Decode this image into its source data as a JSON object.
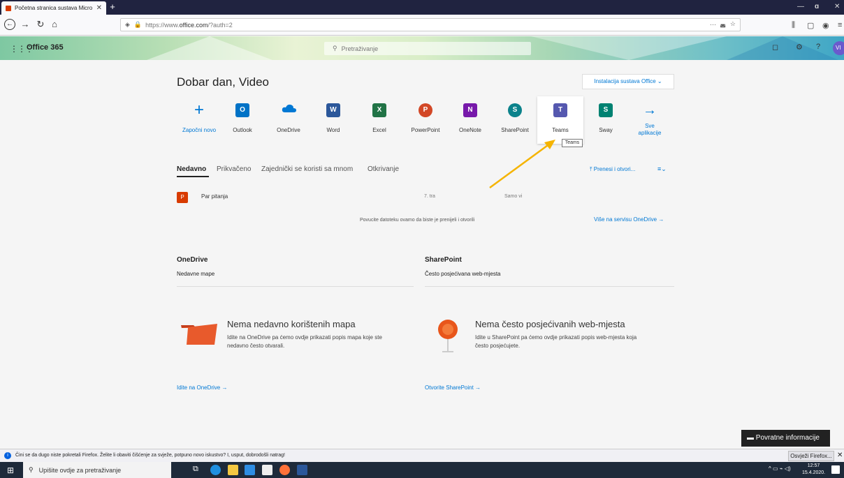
{
  "browser": {
    "tab_title": "Početna stranica sustava Micro",
    "url_prefix": "https://www.",
    "url_domain": "office.com",
    "url_path": "/?auth=2"
  },
  "header": {
    "brand": "Office 365",
    "search_placeholder": "Pretraživanje"
  },
  "main": {
    "greeting": "Dobar dan, Video",
    "install_label": "Instalacija sustava Office",
    "apps": [
      {
        "label": "Započni novo",
        "icon": "plus-icon",
        "color": "#0078d4"
      },
      {
        "label": "Outlook",
        "icon": "outlook-icon",
        "color": "#0072c6"
      },
      {
        "label": "OneDrive",
        "icon": "onedrive-icon",
        "color": "#0078d4"
      },
      {
        "label": "Word",
        "icon": "word-icon",
        "color": "#2b579a"
      },
      {
        "label": "Excel",
        "icon": "excel-icon",
        "color": "#217346"
      },
      {
        "label": "PowerPoint",
        "icon": "powerpoint-icon",
        "color": "#d24726"
      },
      {
        "label": "OneNote",
        "icon": "onenote-icon",
        "color": "#7719aa"
      },
      {
        "label": "SharePoint",
        "icon": "sharepoint-icon",
        "color": "#0b828b"
      },
      {
        "label": "Teams",
        "icon": "teams-icon",
        "color": "#5558af"
      },
      {
        "label": "Sway",
        "icon": "sway-icon",
        "color": "#008272"
      },
      {
        "label": "Sve aplikacije",
        "icon": "arrow-right-icon",
        "color": "#0078d4"
      }
    ],
    "tooltip": "Teams",
    "recent_tabs": [
      "Nedavno",
      "Prikvačeno",
      "Zajednički se koristi sa mnom",
      "Otkrivanje"
    ],
    "upload_label": "Prenesi i otvori...",
    "file": {
      "name": "Par pitanja",
      "date": "7. tra",
      "sharing": "Samo vi"
    },
    "drop_text": "Povucite datoteku ovamo da biste je prenijeli i otvorili",
    "more_onedrive": "Više na servisu OneDrive",
    "onedrive": {
      "title": "OneDrive",
      "subtitle": "Nedavne mape",
      "empty_title": "Nema nedavno korištenih mapa",
      "empty_text": "Idite na OneDrive pa ćemo ovdje prikazati popis mapa koje ste nedavno često otvarali.",
      "link": "Idite na OneDrive"
    },
    "sharepoint": {
      "title": "SharePoint",
      "subtitle": "Često posjećivana web-mjesta",
      "empty_title": "Nema često posjećivanih web-mjesta",
      "empty_text": "Idite u SharePoint pa ćemo ovdje prikazati popis web-mjesta koja često posjećujete.",
      "link": "Otvorite SharePoint"
    },
    "feedback": "Povratne informacije"
  },
  "notification": {
    "text": "Čini se da dugo niste pokretali Firefox. Želite li obaviti čišćenje za svježe, potpuno novo iskustvo? I, usput, dobrodošli natrag!",
    "button": "Osvježi Firefox..."
  },
  "taskbar": {
    "search_placeholder": "Upišite ovdje za pretraživanje",
    "time": "12:57",
    "date": "15.4.2020."
  }
}
